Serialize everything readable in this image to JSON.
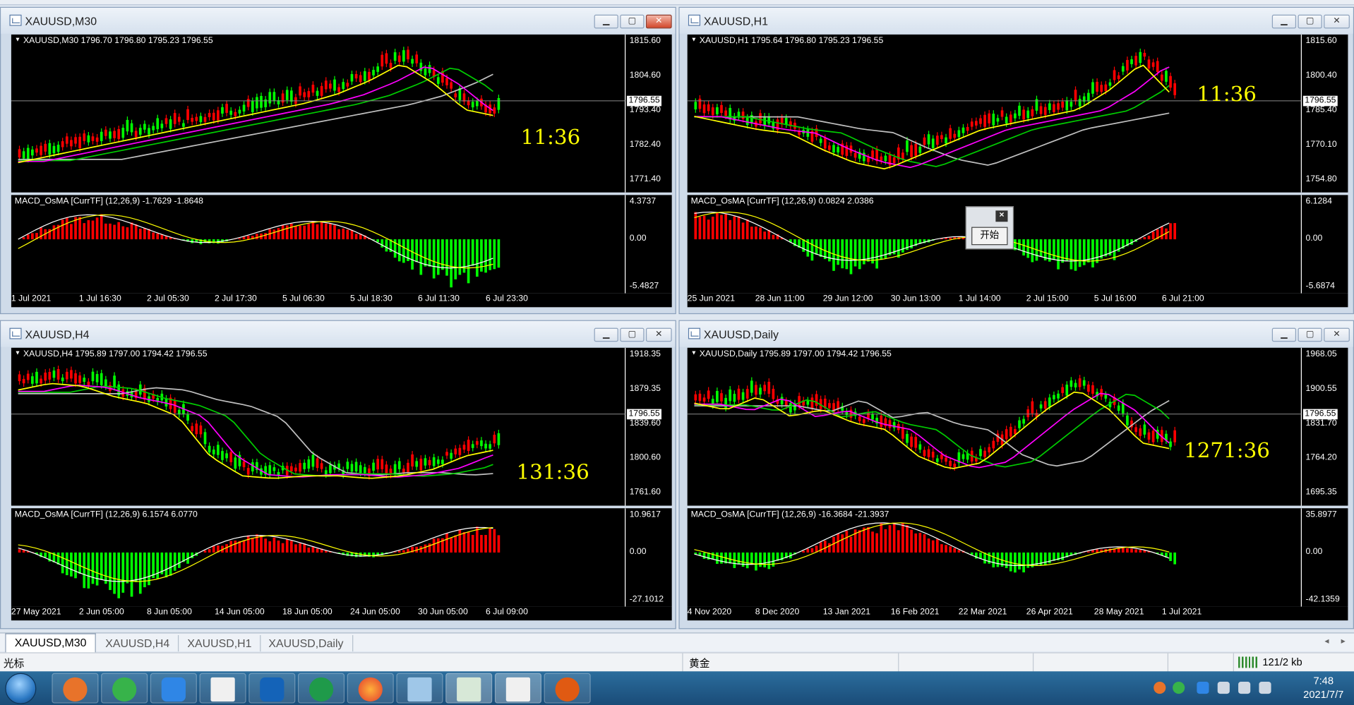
{
  "windows": [
    {
      "id": "m30",
      "title": "XAUUSD,M30",
      "close_active": true,
      "price_header": "XAUUSD,M30  1796.70 1796.80 1795.23 1796.55",
      "price_ticks": [
        "1815.60",
        "1804.60",
        "1793.40",
        "1782.40",
        "1771.40"
      ],
      "current_price": "1796.55",
      "timer": "11:36",
      "macd_header": "MACD_OsMA [CurrTF] (12,26,9) -1.7629 -1.8648",
      "macd_ticks": [
        "4.3737",
        "0.00",
        "-5.4827"
      ],
      "time_ticks": [
        "1 Jul 2021",
        "1 Jul 16:30",
        "2 Jul 05:30",
        "2 Jul 17:30",
        "5 Jul 06:30",
        "5 Jul 18:30",
        "6 Jul 11:30",
        "6 Jul 23:30"
      ]
    },
    {
      "id": "h1",
      "title": "XAUUSD,H1",
      "close_active": false,
      "price_header": "XAUUSD,H1  1795.64 1796.80 1795.23 1796.55",
      "price_ticks": [
        "1815.60",
        "1800.40",
        "1785.40",
        "1770.10",
        "1754.80"
      ],
      "current_price": "1796.55",
      "timer": "11:36",
      "macd_header": "MACD_OsMA [CurrTF] (12,26,9) 0.0824 2.0386",
      "macd_ticks": [
        "6.1284",
        "0.00",
        "-5.6874"
      ],
      "time_ticks": [
        "25 Jun 2021",
        "28 Jun 11:00",
        "29 Jun 12:00",
        "30 Jun 13:00",
        "1 Jul 14:00",
        "2 Jul 15:00",
        "5 Jul 16:00",
        "6 Jul 21:00"
      ]
    },
    {
      "id": "h4",
      "title": "XAUUSD,H4",
      "close_active": false,
      "price_header": "XAUUSD,H4  1795.89 1797.00 1794.42 1796.55",
      "price_ticks": [
        "1918.35",
        "1879.35",
        "1839.60",
        "1800.60",
        "1761.60"
      ],
      "current_price": "1796.55",
      "timer": "131:36",
      "macd_header": "MACD_OsMA [CurrTF] (12,26,9) 6.1574 6.0770",
      "macd_ticks": [
        "10.9617",
        "0.00",
        "-27.1012"
      ],
      "time_ticks": [
        "27 May 2021",
        "2 Jun 05:00",
        "8 Jun 05:00",
        "14 Jun 05:00",
        "18 Jun 05:00",
        "24 Jun 05:00",
        "30 Jun 05:00",
        "6 Jul 09:00"
      ]
    },
    {
      "id": "daily",
      "title": "XAUUSD,Daily",
      "close_active": false,
      "price_header": "XAUUSD,Daily  1795.89 1797.00 1794.42 1796.55",
      "price_ticks": [
        "1968.05",
        "1900.55",
        "1831.70",
        "1764.20",
        "1695.35"
      ],
      "current_price": "1796.55",
      "timer": "1271:36",
      "macd_header": "MACD_OsMA [CurrTF] (12,26,9) -16.3684 -21.3937",
      "macd_ticks": [
        "35.8977",
        "0.00",
        "-42.1359"
      ],
      "time_ticks": [
        "4 Nov 2020",
        "8 Dec 2020",
        "13 Jan 2021",
        "16 Feb 2021",
        "22 Mar 2021",
        "26 Apr 2021",
        "28 May 2021",
        "1 Jul 2021"
      ]
    }
  ],
  "popup": {
    "button_label": "开始",
    "close_glyph": "×"
  },
  "tabs": [
    "XAUUSD,M30",
    "XAUUSD,H4",
    "XAUUSD,H1",
    "XAUUSD,Daily"
  ],
  "active_tab": 0,
  "status": {
    "left": "光标",
    "symbol": "黄金",
    "traffic": "121/2 kb"
  },
  "taskbar": {
    "time": "7:48",
    "date": "2021/7/7"
  },
  "colors": {
    "bull": "#00ff00",
    "bear": "#ff0000",
    "timer": "#ffff00",
    "ma_fast": "#ffff00",
    "ma_mid": "#ff00ff",
    "ma_slow": "#00cc00",
    "ma_long": "#c0c0c0"
  }
}
